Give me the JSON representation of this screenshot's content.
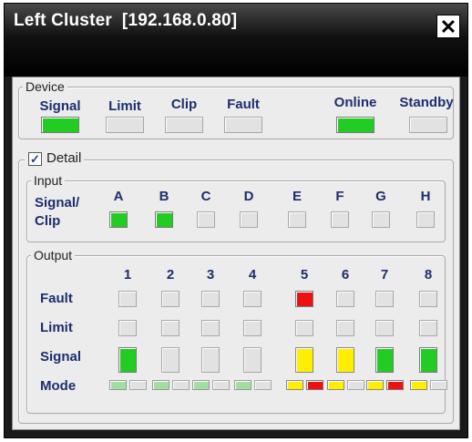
{
  "window": {
    "title": "Left Cluster  [192.168.0.80]",
    "close_symbol": "✕"
  },
  "device": {
    "legend": "Device",
    "labels": {
      "signal": "Signal",
      "limit": "Limit",
      "clip": "Clip",
      "fault": "Fault",
      "online": "Online",
      "standby": "Standby"
    },
    "states": {
      "signal": "on",
      "limit": "off",
      "clip": "off",
      "fault": "off",
      "online": "on",
      "standby": "off"
    }
  },
  "detail": {
    "label": "Detail",
    "checked": true,
    "check_symbol": "✓"
  },
  "input": {
    "legend": "Input",
    "row_label": "Signal/ Clip",
    "channels": [
      "A",
      "B",
      "C",
      "D",
      "E",
      "F",
      "G",
      "H"
    ],
    "states": [
      "on",
      "on",
      "off",
      "off",
      "off",
      "off",
      "off",
      "off"
    ]
  },
  "output": {
    "legend": "Output",
    "channels": [
      "1",
      "2",
      "3",
      "4",
      "5",
      "6",
      "7",
      "8"
    ],
    "row_labels": {
      "fault": "Fault",
      "limit": "Limit",
      "signal": "Signal",
      "mode": "Mode"
    },
    "fault": [
      "off",
      "off",
      "off",
      "off",
      "red",
      "off",
      "off",
      "off"
    ],
    "limit": [
      "off",
      "off",
      "off",
      "off",
      "off",
      "off",
      "off",
      "off"
    ],
    "signal": [
      "green",
      "off",
      "off",
      "off",
      "yellow",
      "yellow",
      "green",
      "green"
    ],
    "mode": [
      [
        "green",
        "off"
      ],
      [
        "green",
        "off"
      ],
      [
        "green",
        "off"
      ],
      [
        "green",
        "off"
      ],
      [
        "yellow",
        "red"
      ],
      [
        "yellow",
        "off"
      ],
      [
        "yellow",
        "red"
      ],
      [
        "yellow",
        "off"
      ]
    ]
  },
  "colors": {
    "green": "#22cc22",
    "red": "#ee1111",
    "yellow": "#ffee00",
    "mode_green": "#9fe09f",
    "label_blue": "#1c2e6e"
  }
}
